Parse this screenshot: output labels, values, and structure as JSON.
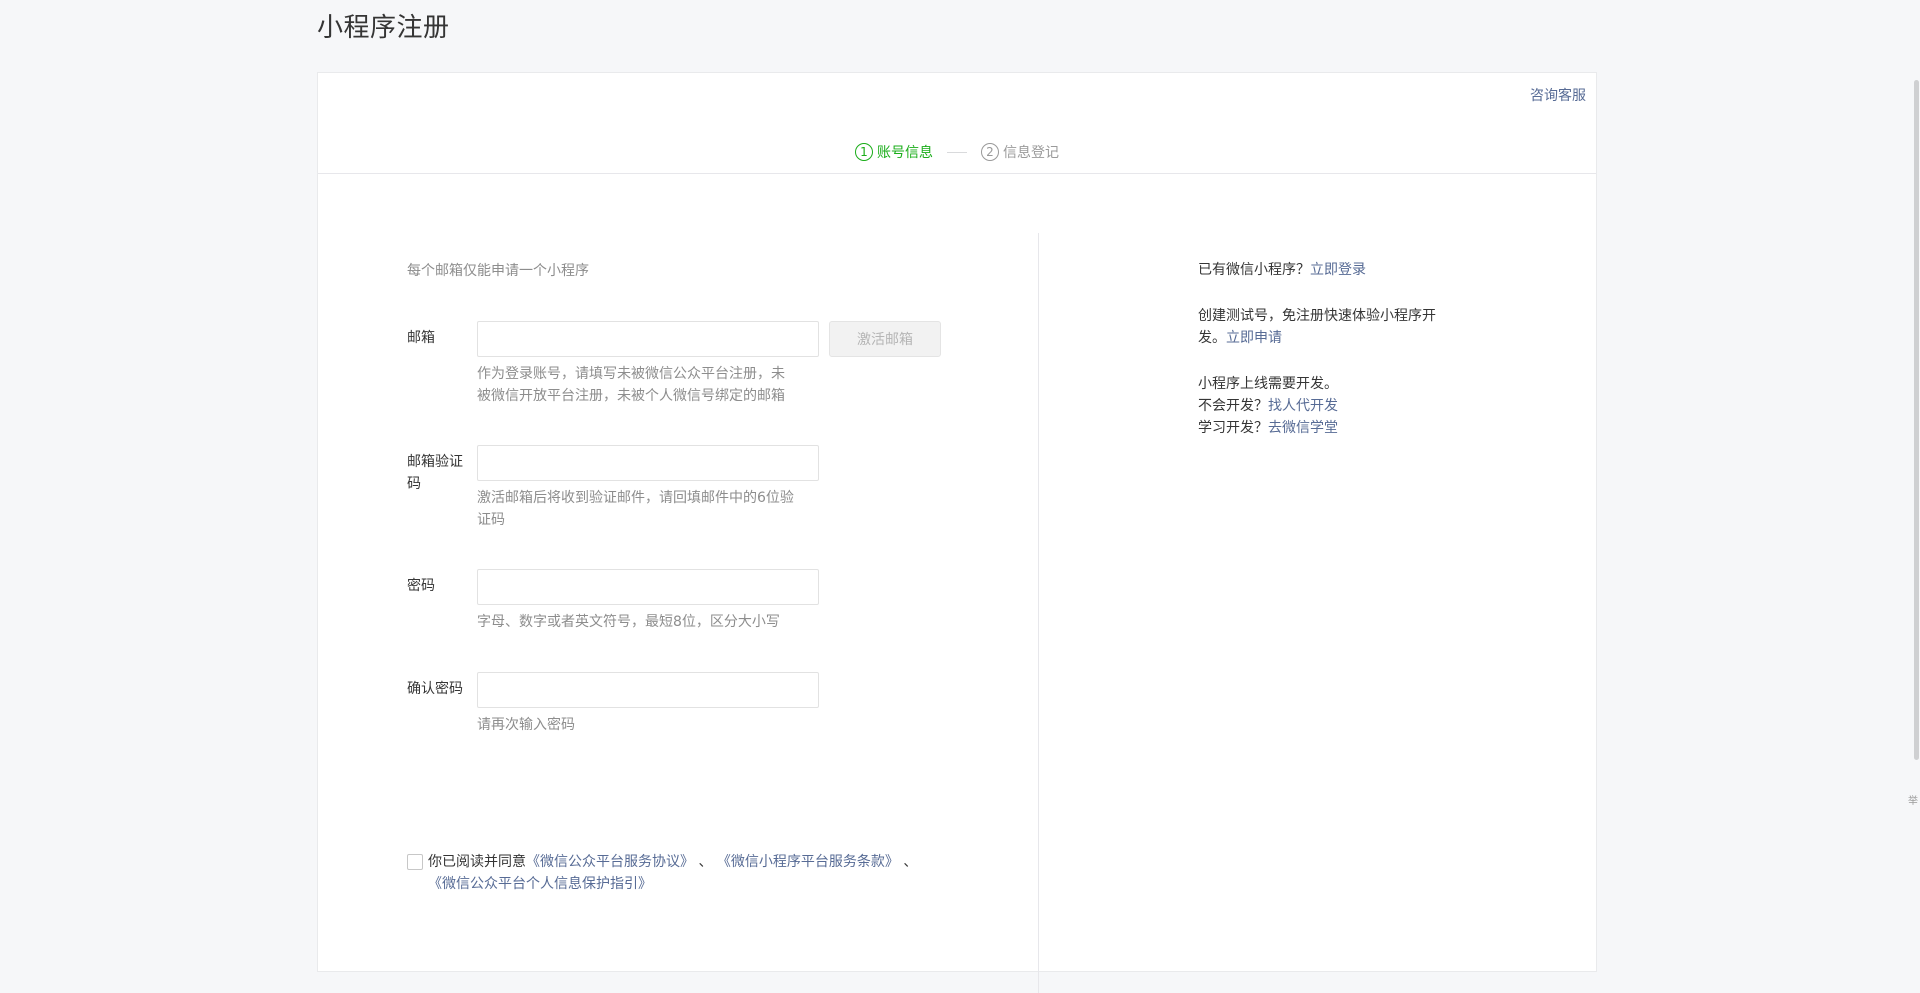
{
  "page": {
    "title": "小程序注册"
  },
  "header": {
    "service_label": "咨询客服"
  },
  "steps": [
    {
      "num": "1",
      "label": "账号信息",
      "active": true
    },
    {
      "num": "2",
      "label": "信息登记",
      "active": false
    }
  ],
  "form": {
    "tip": "每个邮箱仅能申请一个小程序",
    "email": {
      "label": "邮箱",
      "value": "",
      "placeholder": "",
      "activate_button": "激活邮箱",
      "hint": "作为登录账号，请填写未被微信公众平台注册，未被微信开放平台注册，未被个人微信号绑定的邮箱"
    },
    "code": {
      "label": "邮箱验证码",
      "value": "",
      "placeholder": "",
      "hint": "激活邮箱后将收到验证邮件，请回填邮件中的6位验证码"
    },
    "password": {
      "label": "密码",
      "value": "",
      "placeholder": "",
      "hint": "字母、数字或者英文符号，最短8位，区分大小写"
    },
    "confirm": {
      "label": "确认密码",
      "value": "",
      "placeholder": "",
      "hint": "请再次输入密码"
    },
    "agreement": {
      "prefix": "你已阅读并同意",
      "link1": "《微信公众平台服务协议》",
      "sep1": "、",
      "link2": "《微信小程序平台服务条款》",
      "sep2": "、",
      "link3": "《微信公众平台个人信息保护指引》"
    }
  },
  "sidebar": {
    "login_prefix": "已有微信小程序？",
    "login_link": "立即登录",
    "test_prefix": "创建测试号，免注册快速体验小程序开发。",
    "test_link": "立即申请",
    "dev_note": "小程序上线需要开发。",
    "hire_prefix": "不会开发？",
    "hire_link": "找人代开发",
    "learn_prefix": "学习开发？",
    "learn_link": "去微信学堂"
  },
  "side_tab": {
    "label": "举"
  },
  "colors": {
    "accent_green": "#1aad19",
    "link_blue": "#576b95",
    "muted": "#8d8d8d"
  }
}
